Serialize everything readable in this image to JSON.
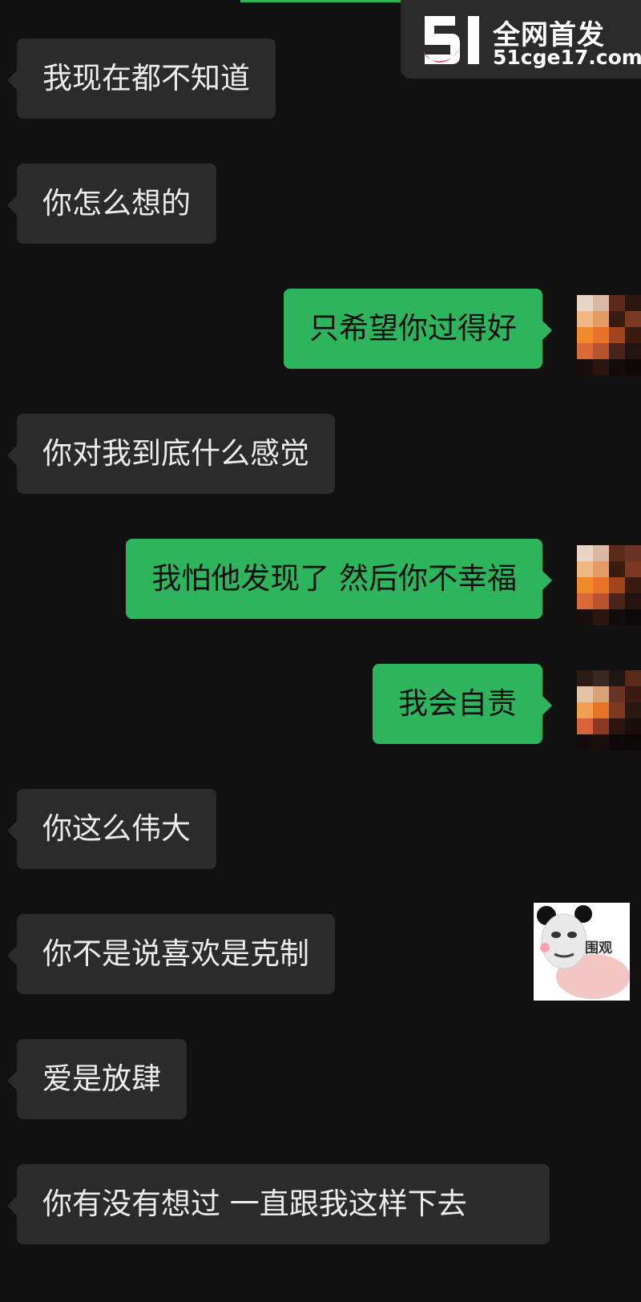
{
  "watermark": {
    "logo_text": "51",
    "line1": "全网首发",
    "line2": "51cge17.com"
  },
  "messages": [
    {
      "side": "left",
      "text": "我现在都不知道"
    },
    {
      "side": "left",
      "text": "你怎么想的"
    },
    {
      "side": "right",
      "text": "只希望你过得好"
    },
    {
      "side": "left",
      "text": "你对我到底什么感觉"
    },
    {
      "side": "right",
      "text": "我怕他发现了  然后你不幸福"
    },
    {
      "side": "right",
      "text": "我会自责"
    },
    {
      "side": "left",
      "text": "你这么伟大"
    },
    {
      "side": "left",
      "text": "你不是说喜欢是克制"
    },
    {
      "side": "left",
      "text": "爱是放肆"
    },
    {
      "side": "left",
      "text": "你有没有想过 一直跟我这样下去"
    }
  ],
  "sticker": {
    "label": "围观",
    "icon": "panda-meme-sticker"
  },
  "colors": {
    "background": "#111111",
    "incoming_bubble": "#2b2b2b",
    "outgoing_bubble": "#2fb45e",
    "watermark_accent": "#e8507a"
  }
}
